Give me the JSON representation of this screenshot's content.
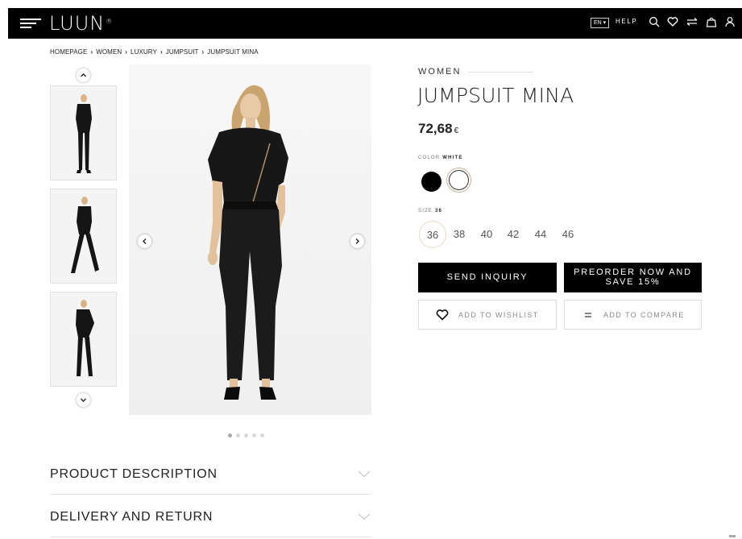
{
  "header": {
    "logo": "LUUN",
    "logo_mark": "®",
    "language": "EN",
    "help": "HELP",
    "icons": [
      "menu-icon",
      "search-icon",
      "heart-icon",
      "compare-icon",
      "bag-icon",
      "user-icon"
    ],
    "background": "#000000"
  },
  "breadcrumb": [
    "HOMEPAGE",
    "WOMEN",
    "LUXURY",
    "JUMPSUIT",
    "JUMPSUIT MINA"
  ],
  "product": {
    "category": "WOMEN",
    "title": "JUMPSUIT MINA",
    "price": "72,68",
    "currency": "€",
    "color_label": "COLOR",
    "color_value": "WHITE",
    "colors": [
      {
        "name": "black",
        "hex": "#000000"
      },
      {
        "name": "white",
        "hex": "#ffffff"
      }
    ],
    "size_label": "SIZE",
    "size_value": "36",
    "sizes": [
      "36",
      "38",
      "40",
      "42",
      "44",
      "46"
    ]
  },
  "actions": {
    "send_inquiry": "SEND INQUIRY",
    "preorder_line1": "PREORDER NOW AND",
    "preorder_line2": "SAVE 15%",
    "wishlist": "ADD TO WISHLIST",
    "compare": "ADD TO COMPARE"
  },
  "gallery": {
    "thumbnails": 3,
    "slide_count": 5,
    "active_slide": 1
  },
  "accordion": [
    "PRODUCT DESCRIPTION",
    "DELIVERY AND RETURN"
  ]
}
